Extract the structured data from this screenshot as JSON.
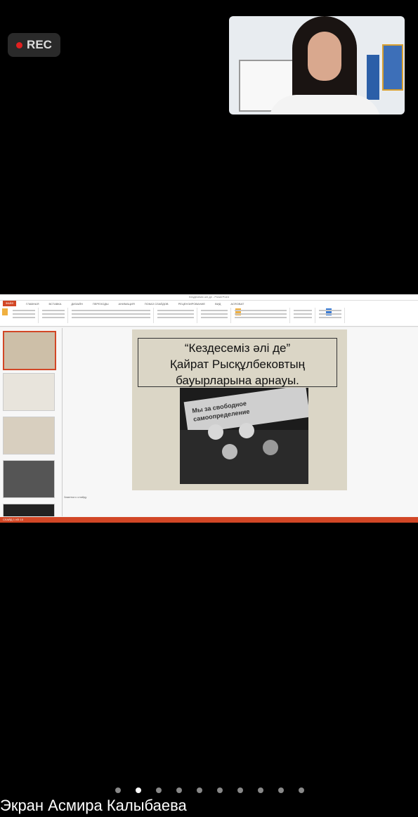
{
  "recording": {
    "label": "REC"
  },
  "presentation": {
    "window_title": "Кездесеміз әлі де - PowerPoint",
    "tabs": [
      "ФАЙЛ",
      "ГЛАВНАЯ",
      "ВСТАВКА",
      "ДИЗАЙН",
      "ПЕРЕХОДЫ",
      "АНИМАЦИЯ",
      "ПОКАЗ СЛАЙДОВ",
      "РЕЦЕНЗИРОВАНИЕ",
      "ВИД",
      "ACROBAT"
    ],
    "slide_title_lines": [
      "“Кездесеміз әлі де”",
      "Қайрат Рысқұлбековтың",
      "бауырларына арнауы."
    ],
    "photo_banner_text": "Мы за свободное самоопределение",
    "notes_placeholder": "Заметки к слайду",
    "status_text": "СЛАЙД 1 ИЗ 10"
  },
  "pagination": {
    "count": 10,
    "active_index": 1
  },
  "caption": "Экран Асмира Калыбаева"
}
